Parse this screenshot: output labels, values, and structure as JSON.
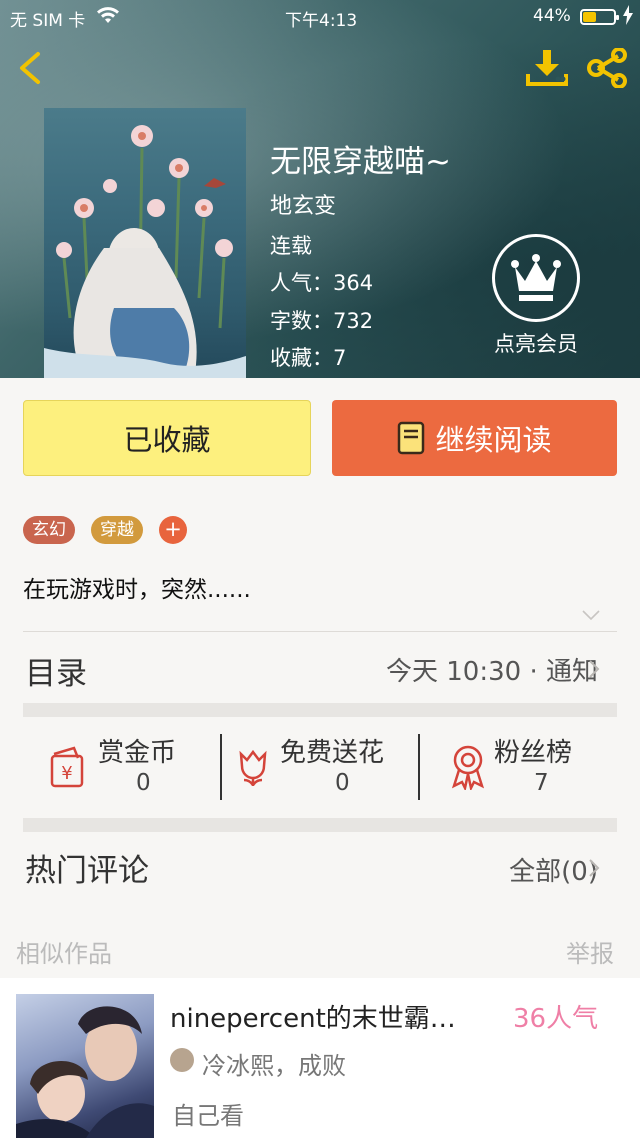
{
  "status_bar": {
    "carrier": "无 SIM 卡",
    "time": "下午4:13",
    "battery": "44%"
  },
  "book": {
    "title": "无限穿越喵~",
    "author": "地玄变",
    "status": "连载",
    "popularity": "人气：364",
    "word_count": "字数：732",
    "favorites": "收藏：7"
  },
  "vip": {
    "label": "点亮会员"
  },
  "actions": {
    "favorite_label": "已收藏",
    "read_label": "继续阅读"
  },
  "tags": [
    "玄幻",
    "穿越"
  ],
  "tag_add": "+",
  "description": "在玩游戏时，突然......",
  "toc": {
    "title": "目录",
    "update": "今天 10:30 · 通知"
  },
  "stats": [
    {
      "label": "赏金币",
      "value": "0"
    },
    {
      "label": "免费送花",
      "value": "0"
    },
    {
      "label": "粉丝榜",
      "value": "7"
    }
  ],
  "comments": {
    "title": "热门评论",
    "all": "全部(0)"
  },
  "similar": {
    "section_label": "相似作品",
    "report_label": "举报"
  },
  "similar_book": {
    "title": "ninepercent的末世霸…",
    "popularity": "36人气",
    "author": "冷冰熙，成败",
    "description": "自己看"
  },
  "colors": {
    "accent": "#ec6a40",
    "favorite_bg": "#fdf07e",
    "popularity_pink": "#ef7fa6"
  }
}
